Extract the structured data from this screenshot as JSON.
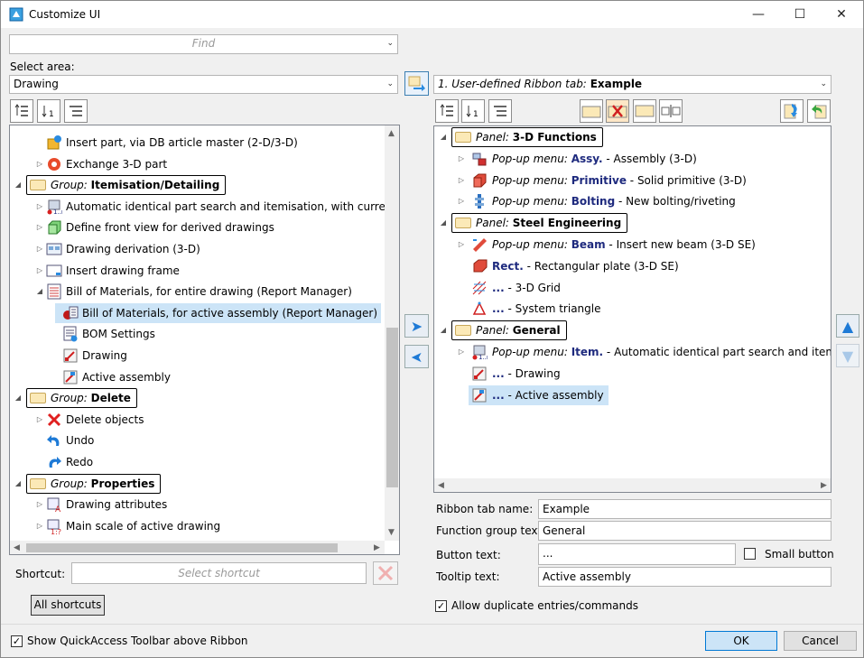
{
  "window": {
    "title": "Customize UI"
  },
  "find": {
    "placeholder": "Find"
  },
  "select_area": {
    "label": "Select area:",
    "value": "Drawing"
  },
  "left_tree": [
    {
      "label": "Insert part, via DB article master (2-D/3-D)",
      "type": "item",
      "indent": 1,
      "expander": false,
      "icon": "db-part-icon"
    },
    {
      "label": "Exchange 3-D part",
      "type": "item",
      "indent": 1,
      "expander": true,
      "icon": "exchange-part-icon"
    },
    {
      "prefix": "Group:",
      "label": "Itemisation/Detailing",
      "type": "group"
    },
    {
      "label": "Automatic identical part search and itemisation, with current parar",
      "type": "item",
      "indent": 1,
      "expander": true,
      "icon": "itemisation-icon"
    },
    {
      "label": "Define front view for derived drawings",
      "type": "item",
      "indent": 1,
      "expander": true,
      "icon": "front-view-icon"
    },
    {
      "label": "Drawing derivation (3-D)",
      "type": "item",
      "indent": 1,
      "expander": true,
      "icon": "derivation-icon"
    },
    {
      "label": "Insert drawing frame",
      "type": "item",
      "indent": 1,
      "expander": true,
      "icon": "frame-icon"
    },
    {
      "label": "Bill of Materials, for entire drawing (Report Manager)",
      "type": "item",
      "indent": 1,
      "expander": "open",
      "icon": "bom-icon"
    },
    {
      "label": "Bill of Materials, for active assembly (Report Manager)",
      "type": "item",
      "indent": 2,
      "expander": false,
      "icon": "bom-assembly-icon",
      "selected": true
    },
    {
      "label": "BOM Settings",
      "type": "item",
      "indent": 2,
      "expander": false,
      "icon": "bom-settings-icon"
    },
    {
      "label": "Drawing",
      "type": "item",
      "indent": 2,
      "expander": false,
      "icon": "drawing-icon"
    },
    {
      "label": "Active assembly",
      "type": "item",
      "indent": 2,
      "expander": false,
      "icon": "assembly-icon"
    },
    {
      "prefix": "Group:",
      "label": "Delete",
      "type": "group"
    },
    {
      "label": "Delete objects",
      "type": "item",
      "indent": 1,
      "expander": true,
      "icon": "delete-icon"
    },
    {
      "label": "Undo",
      "type": "item",
      "indent": 1,
      "expander": false,
      "icon": "undo-icon"
    },
    {
      "label": "Redo",
      "type": "item",
      "indent": 1,
      "expander": false,
      "icon": "redo-icon"
    },
    {
      "prefix": "Group:",
      "label": "Properties",
      "type": "group"
    },
    {
      "label": "Drawing attributes",
      "type": "item",
      "indent": 1,
      "expander": true,
      "icon": "attributes-icon"
    },
    {
      "label": "Main scale of  active drawing",
      "type": "item",
      "indent": 1,
      "expander": true,
      "icon": "scale-icon"
    }
  ],
  "ribbon_select": {
    "prefix": "1. User-defined Ribbon tab:",
    "value": "Example"
  },
  "right_tree": [
    {
      "type": "panel",
      "prefix": "Panel:",
      "label": "3-D Functions"
    },
    {
      "type": "item",
      "expander": true,
      "icon": "assembly-popup-icon",
      "kind": "Pop-up menu:",
      "key": "Assy.",
      "text": "Assembly (3-D)"
    },
    {
      "type": "item",
      "expander": true,
      "icon": "primitive-icon",
      "kind": "Pop-up menu:",
      "key": "Primitive",
      "text": "Solid primitive (3-D)"
    },
    {
      "type": "item",
      "expander": true,
      "icon": "bolting-icon",
      "kind": "Pop-up menu:",
      "key": "Bolting",
      "text": "New bolting/riveting"
    },
    {
      "type": "panel",
      "prefix": "Panel:",
      "label": "Steel Engineering"
    },
    {
      "type": "item",
      "expander": true,
      "icon": "beam-icon",
      "kind": "Pop-up menu:",
      "key": "Beam",
      "text": "Insert new beam (3-D SE)"
    },
    {
      "type": "item",
      "expander": false,
      "icon": "plate-icon",
      "kind": "",
      "key": "Rect.",
      "text": "Rectangular plate (3-D SE)"
    },
    {
      "type": "item",
      "expander": false,
      "icon": "grid-icon",
      "kind": "",
      "key": "...",
      "text": "3-D Grid"
    },
    {
      "type": "item",
      "expander": false,
      "icon": "triangle-icon",
      "kind": "",
      "key": "...",
      "text": "System triangle"
    },
    {
      "type": "panel",
      "prefix": "Panel:",
      "label": "General"
    },
    {
      "type": "item",
      "expander": true,
      "icon": "itemisation-icon",
      "kind": "Pop-up menu:",
      "key": "Item.",
      "text": "Automatic identical part search and itemisation,"
    },
    {
      "type": "item",
      "expander": false,
      "icon": "drawing-icon",
      "kind": "",
      "key": "...",
      "text": "Drawing"
    },
    {
      "type": "item",
      "expander": false,
      "icon": "assembly-icon",
      "kind": "",
      "key": "...",
      "text": "Active assembly",
      "selected": true
    }
  ],
  "props": {
    "ribbon_tab_name": {
      "label": "Ribbon tab name:",
      "value": "Example"
    },
    "function_group_text": {
      "label": "Function group text:",
      "value": "General"
    },
    "button_text": {
      "label": "Button text:",
      "value": "..."
    },
    "small_button": {
      "label": "Small button",
      "checked": false
    },
    "tooltip_text": {
      "label": "Tooltip text:",
      "value": "Active assembly"
    }
  },
  "shortcut": {
    "label": "Shortcut:",
    "placeholder": "Select shortcut"
  },
  "all_shortcuts": "All shortcuts",
  "allow_duplicates": {
    "label": "Allow duplicate entries/commands",
    "checked": true
  },
  "show_qat": {
    "label": "Show QuickAccess Toolbar above Ribbon",
    "checked": true
  },
  "buttons": {
    "ok": "OK",
    "cancel": "Cancel"
  },
  "colors": {
    "accent": "#0078d4",
    "selection": "#cce4f7",
    "group_folder": "#fbe9b7",
    "key_text": "#1e2a7e"
  }
}
